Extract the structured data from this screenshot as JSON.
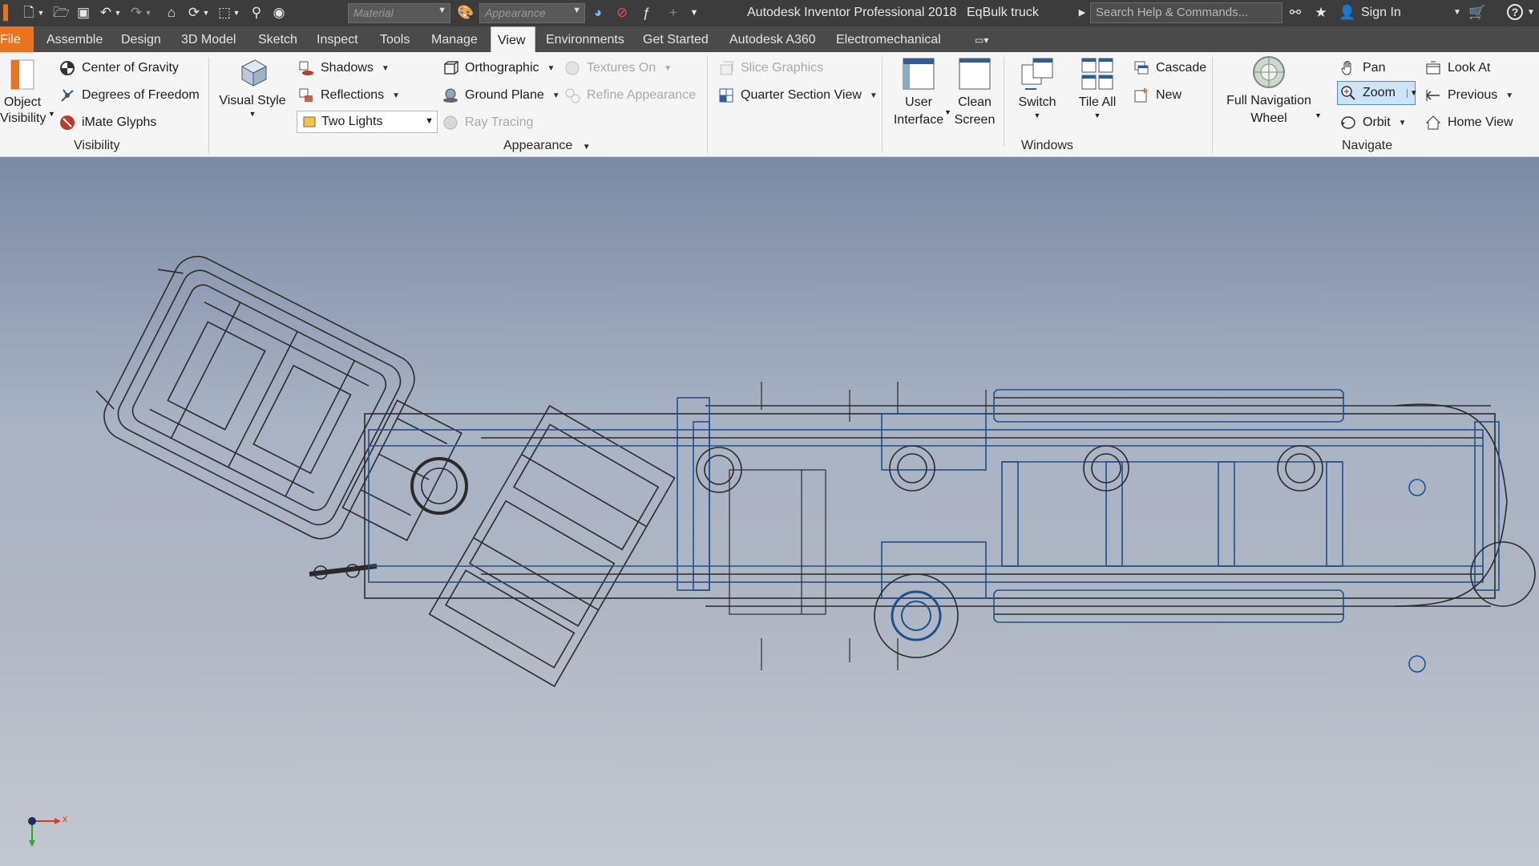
{
  "titlebar": {
    "material_placeholder": "Material",
    "appearance_placeholder": "Appearance",
    "app_title": "Autodesk Inventor Professional 2018",
    "document_title": "EqBulk truck",
    "search_placeholder": "Search Help & Commands...",
    "sign_in": "Sign In",
    "help": "?"
  },
  "tabs": [
    "File",
    "Assemble",
    "Design",
    "3D Model",
    "Sketch",
    "Inspect",
    "Tools",
    "Manage",
    "View",
    "Environments",
    "Get Started",
    "Autodesk A360",
    "Electromechanical"
  ],
  "active_tab": "View",
  "ribbon": {
    "visibility": {
      "object_visibility": [
        "Object",
        "Visibility"
      ],
      "center_of_gravity": "Center of Gravity",
      "degrees_of_freedom": "Degrees of Freedom",
      "imate_glyphs": "iMate Glyphs",
      "group_label": "Visibility"
    },
    "appearance": {
      "visual_style": "Visual Style",
      "shadows": "Shadows",
      "reflections": "Reflections",
      "lighting": "Two Lights",
      "orthographic": "Orthographic",
      "ground_plane": "Ground Plane",
      "ray_tracing": "Ray Tracing",
      "textures_on": "Textures On",
      "refine_appearance": "Refine Appearance",
      "group_label": "Appearance"
    },
    "section": {
      "slice_graphics": "Slice Graphics",
      "quarter_section_view": "Quarter Section View"
    },
    "windows": {
      "user_interface": [
        "User",
        "Interface"
      ],
      "clean_screen": [
        "Clean",
        "Screen"
      ],
      "switch": "Switch",
      "tile_all": "Tile All",
      "cascade": "Cascade",
      "new": "New",
      "group_label": "Windows"
    },
    "navigate": {
      "full_navigation_wheel": [
        "Full Navigation",
        "Wheel"
      ],
      "pan": "Pan",
      "zoom": "Zoom",
      "orbit": "Orbit",
      "look_at": "Look At",
      "previous": "Previous",
      "home_view": "Home View",
      "group_label": "Navigate"
    }
  },
  "viewport": {
    "axis_x_label": "x"
  },
  "colors": {
    "file_tab": "#e9731e",
    "titlebar": "#3c3c3c",
    "wire_dark": "#2b2b2b",
    "wire_blue": "#1e4f93",
    "axis_x": "#d23a2a",
    "axis_y": "#2aa63a"
  }
}
